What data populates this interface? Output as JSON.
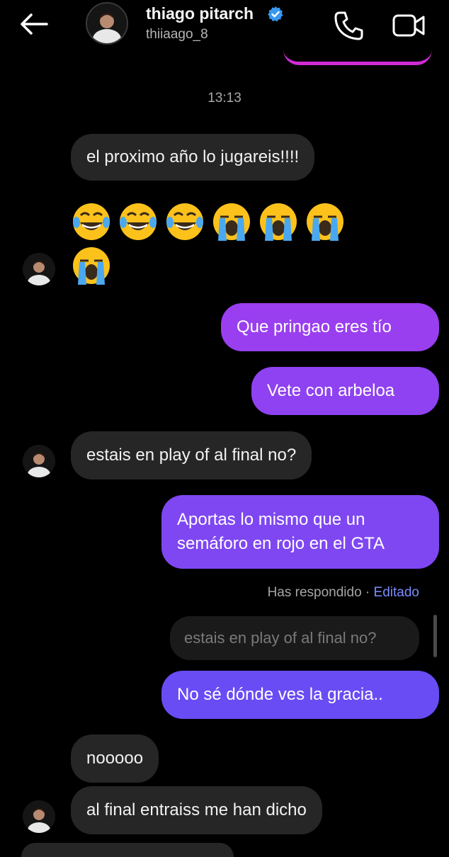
{
  "header": {
    "contact_name": "thiago pitarch",
    "username": "thiiaago_8"
  },
  "chat": {
    "timestamp": "13:13",
    "messages": [
      {
        "from": "them",
        "text": "el proximo año lo jugareis!!!!"
      },
      {
        "from": "them",
        "text": "😂😂😂😭😭😭😭"
      },
      {
        "from": "me",
        "text": "Que pringao eres tío"
      },
      {
        "from": "me",
        "text": "Vete con arbeloa"
      },
      {
        "from": "them",
        "text": "estais en play of al final no?"
      },
      {
        "from": "me",
        "lines": [
          "Aportas lo mismo que un",
          "semáforo en rojo en el GTA"
        ]
      },
      {
        "from": "me",
        "text": "No sé dónde ves la gracia.."
      },
      {
        "from": "them",
        "text": "nooooo"
      },
      {
        "from": "them",
        "text": "al final entraiss me han dicho"
      }
    ],
    "reply_meta": {
      "label": "Has respondido",
      "separator": " · ",
      "edited": "Editado"
    },
    "quoted_text": "estais en play of al final no?"
  },
  "icons": {
    "back": "arrow-left-icon",
    "verified": "verified-badge-icon",
    "call": "phone-icon",
    "video": "video-camera-icon"
  },
  "colors": {
    "background": "#000000",
    "received_bubble": "#262626",
    "sent_bubble_top": "#9a3ff0",
    "sent_bubble_bottom": "#6a4cf4",
    "verified": "#3897f0",
    "edited_link": "#7b8cff"
  }
}
